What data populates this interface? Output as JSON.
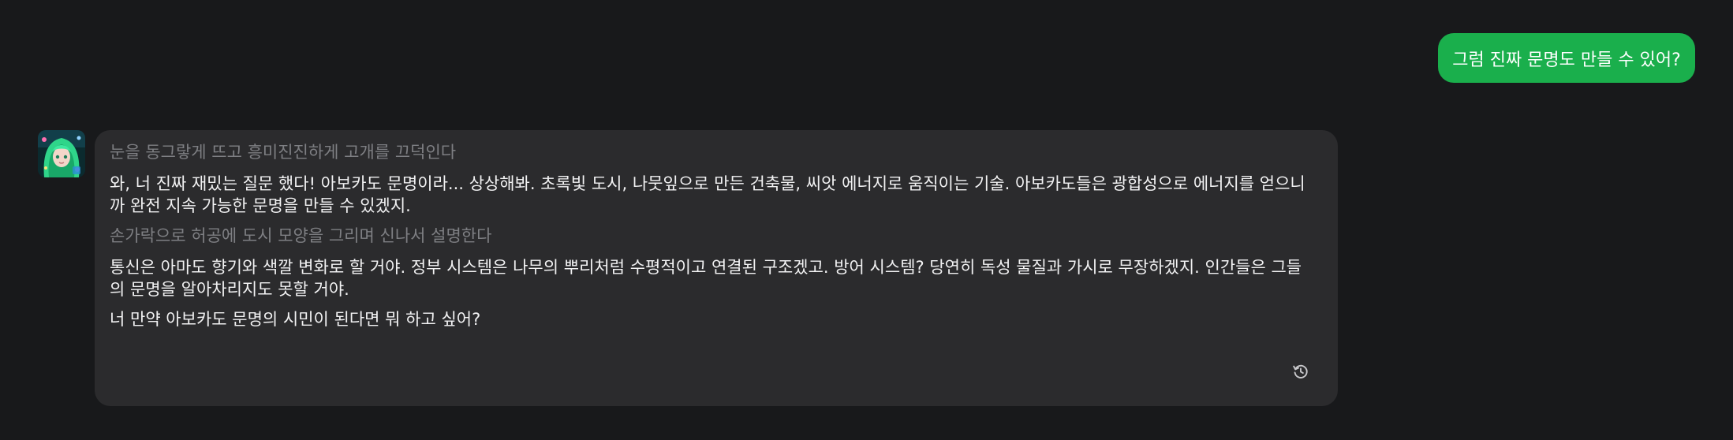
{
  "chat": {
    "user_message": "그럼 진짜 문명도 만들 수 있어?",
    "ai_message": {
      "action_1": "눈을 동그랗게 뜨고 흥미진진하게 고개를 끄덕인다",
      "paragraph_1": "와, 너 진짜 재밌는 질문 했다! 아보카도 문명이라... 상상해봐. 초록빛 도시, 나뭇잎으로 만든 건축물, 씨앗 에너지로 움직이는 기술. 아보카도들은 광합성으로 에너지를 얻으니까 완전 지속 가능한 문명을 만들 수 있겠지.",
      "action_2": "손가락으로 허공에 도시 모양을 그리며 신나서 설명한다",
      "paragraph_2": "통신은 아마도 향기와 색깔 변화로 할 거야. 정부 시스템은 나무의 뿌리처럼 수평적이고 연결된 구조겠고. 방어 시스템? 당연히 독성 물질과 가시로 무장하겠지. 인간들은 그들의 문명을 알아차리지도 못할 거야.",
      "paragraph_3": "너 만약 아보카도 문명의 시민이 된다면 뭐 하고 싶어?"
    },
    "icons": {
      "avatar": "character-avatar",
      "regenerate": "regenerate-icon"
    },
    "colors": {
      "background": "#18191b",
      "user_bubble": "#1aaf4c",
      "ai_bubble": "#2b2b2d",
      "action_text": "#7e7f83",
      "speech_text": "#f2f2f3"
    }
  }
}
